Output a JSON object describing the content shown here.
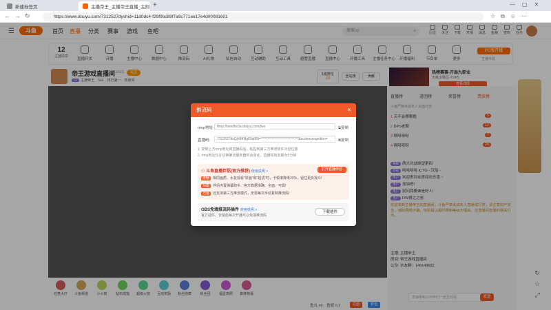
{
  "browser": {
    "tabs": [
      {
        "label": "新建标签页"
      },
      {
        "label": "主播帝王_主播帝王直播_主则"
      }
    ],
    "url": "https://www.douyu.com/7312527dyshid=11d0dc4-f29f0bc89f7a9c771ee17e4d00081601"
  },
  "nav": {
    "logo": "斗鱼",
    "items": [
      "首页",
      "直播",
      "分类",
      "赛事",
      "游戏",
      "鱼吧"
    ],
    "search_placeholder": "搜索up",
    "right_icons": [
      "历史",
      "关注",
      "下载",
      "开播",
      "消息",
      "鱼粮",
      "签到",
      "任务"
    ]
  },
  "categories": {
    "count": "12",
    "count_label": "主播勋章",
    "items": [
      "直播开关",
      "开播",
      "主播中心",
      "数据中心",
      "推流码",
      "AI礼物",
      "私信自动",
      "互动辅助",
      "互动工具",
      "超管直播",
      "直播中心",
      "开播工具",
      "主播任务中心",
      "开播福利",
      "节目单",
      "更多"
    ],
    "pc_btn": "PC版开播",
    "pc_sub": "主播专属"
  },
  "room": {
    "title": "帝王游戏直播间",
    "room_no": "212601",
    "follow": "关注",
    "streamer": "主播帝王",
    "stats": [
      "544",
      "排行第一",
      "热度高"
    ],
    "rank": "1/3",
    "rank_label": "全站榜",
    "contribute": "贡献",
    "banner": "热榜赛事-开局九职业",
    "banner_sub": "天赋本赛区-TOP5",
    "banner_btn": "查看详情"
  },
  "modal": {
    "title": "推流码",
    "rtmp_label": "rtmp地址:",
    "rtmp_value": "rtmp://sendtw3a.douyu.com/live",
    "code_label": "直播码:",
    "code_value": "7312527dsQjhB4Ng83q0Ri=****************************&acdoexcognition=",
    "copy": "复制",
    "notes": [
      "1. 复制上方rtmp地址和直播码后，粘贴到第三方推流软件对应位置",
      "2. rtmp地址仅在切换推流服务器时会变化，直播码有效期为5分钟"
    ],
    "promo_title": "斗鱼直播伴侣(官方推荐)",
    "promo_link": "使用说明 >",
    "promo_btn": "打开直播伴侣",
    "promo_lines": [
      {
        "tag": "流畅",
        "text": "相同画质、水友观看\"原画\"和\"超清\"时，卡顿率降低20%，留住更多观众!"
      },
      {
        "tag": "功能",
        "text": "伴侣内置弹幕助手、官方数据准确、全面、可靠!"
      },
      {
        "tag": "方便",
        "text": "还支持第三方推流模式，无需每次手动复制推流码!"
      }
    ],
    "plugin_title": "OBS免填推流码插件",
    "plugin_link": "使用说明 >",
    "plugin_desc": "官方插件，安装后每次开播可以免填推流码",
    "plugin_btn": "下载插件"
  },
  "panel": {
    "tabs": [
      "直播榜",
      "道团榜",
      "荣誉榜",
      "贵族榜"
    ],
    "rank_hint": "斗鱼严禁未成年人充值打赏",
    "rank": [
      {
        "no": "1",
        "name": "天不会哪哪抱",
        "lvl": "5"
      },
      {
        "no": "2",
        "name": "DPS老聊",
        "lvl": "12"
      },
      {
        "no": "3",
        "name": "啊呀呀呀",
        "lvl": "7"
      },
      {
        "no": "4",
        "name": "啊呀呀呀",
        "lvl": "24"
      }
    ],
    "chat": [
      {
        "badge": "系统",
        "text": "两大对战欲望第四"
      },
      {
        "badge": "吉祥",
        "text": "哈哈哈哈 ICTG - 沉船 -"
      },
      {
        "badge": "用户",
        "text": "欢迎来到本房间欢乐喜 ~"
      },
      {
        "badge": "用户",
        "text": "加油吧!"
      },
      {
        "badge": "用户",
        "text": "别问我要谁是好人!"
      },
      {
        "badge": "用户",
        "text": "DW哥之之恶"
      }
    ],
    "notice": "欢迎来到主播帝王的直播间，斗鱼严禁未成年人直播或打赏，请注意财产安全，谨防网络诈骗，特别是以超时限制等级为理由，在直播间直播的相关行为。",
    "info": [
      {
        "k": "主播:",
        "v": "主播帝王"
      },
      {
        "k": "房间:",
        "v": "帝王游戏直播间"
      },
      {
        "k": "公众:",
        "v": "水友群：149143682"
      }
    ],
    "input_placeholder": "发弹幕和小伙伴们一起互动吧",
    "send": "发送"
  },
  "bottom": {
    "gifts": [
      "任意大厅",
      "斗鱼频道",
      "小火箭",
      "钻石戒指",
      "超级火箭",
      "互动奖励",
      "粉丝勋章",
      "粉丝团",
      "福星高照",
      "森林物语"
    ],
    "fish": "鱼丸 46",
    "barrage": "鱼翅 0.2",
    "btn1": "充值",
    "btn2": "背包"
  },
  "colors": {
    "accent": "#f05a28",
    "brand": "#ff6c00"
  }
}
